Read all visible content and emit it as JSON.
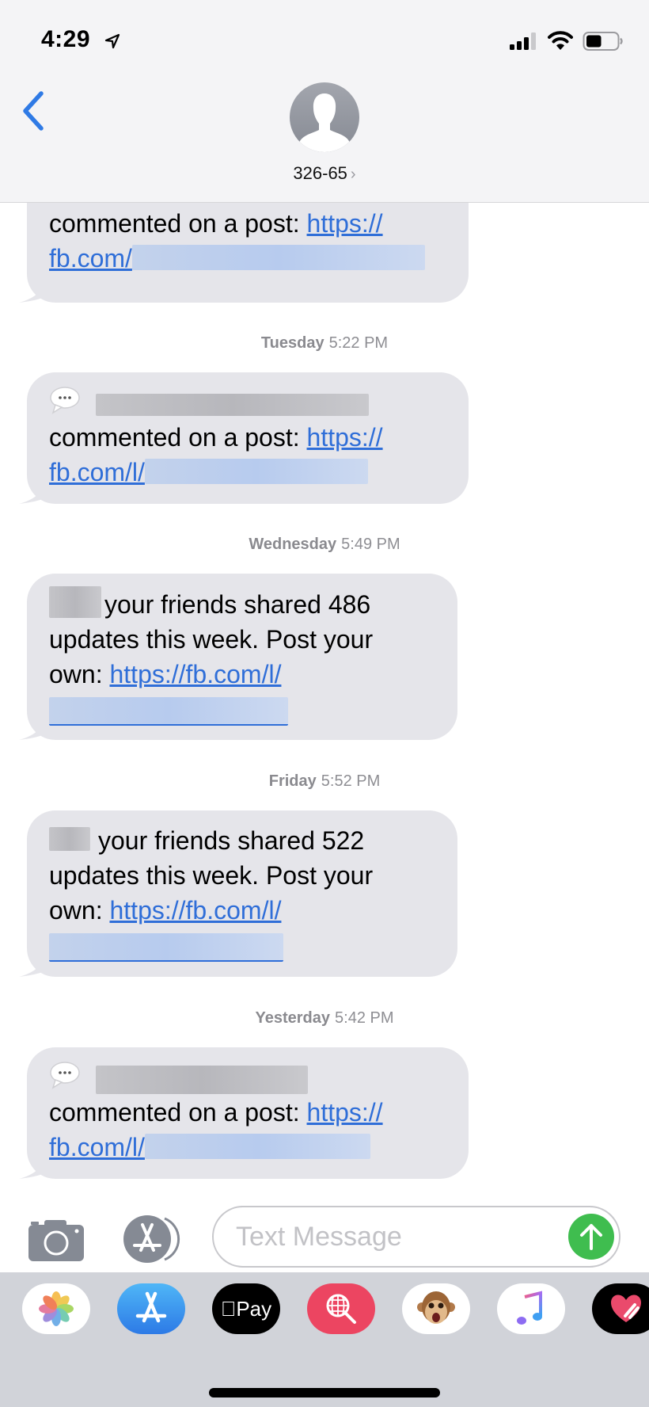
{
  "status_bar": {
    "time": "4:29",
    "location_icon": "location-arrow-icon",
    "signal_bars": 3,
    "signal_max": 4,
    "battery_level": 0.5
  },
  "header": {
    "back_icon": "chevron-left-icon",
    "contact_name": "326-65",
    "contact_chevron": "›",
    "avatar_icon": "person-silhouette-icon"
  },
  "messages": [
    {
      "type": "comment",
      "timestamp": null,
      "has_emoji": true,
      "body_text": "commented on a post:",
      "link_prefix": "https://",
      "link_line2": "fb.com/"
    },
    {
      "type": "comment",
      "timestamp": {
        "day": "Tuesday",
        "time": "5:22 PM"
      },
      "has_emoji": true,
      "body_text": "commented on a post:",
      "link_prefix": "https://",
      "link_line2": "fb.com/l/"
    },
    {
      "type": "weekly",
      "timestamp": {
        "day": "Wednesday",
        "time": "5:49 PM"
      },
      "line1": "your friends shared 486",
      "line2": "updates this week. Post your",
      "line3_text": "own:",
      "line3_link": "https://fb.com/l/"
    },
    {
      "type": "weekly",
      "timestamp": {
        "day": "Friday",
        "time": "5:52 PM"
      },
      "line1": "your friends shared 522",
      "line2": "updates this week. Post your",
      "line3_text": "own:",
      "line3_link": "https://fb.com/l/"
    },
    {
      "type": "comment",
      "timestamp": {
        "day": "Yesterday",
        "time": "5:42 PM"
      },
      "has_emoji": true,
      "body_text": "commented on a post:",
      "link_prefix": "https://",
      "link_line2": "fb.com/l/"
    }
  ],
  "composer": {
    "camera_icon": "camera-icon",
    "apps_icon": "app-store-icon",
    "placeholder": "Text Message",
    "send_icon": "arrow-up-icon",
    "send_color": "#3fbd4f"
  },
  "app_drawer": {
    "apps": [
      {
        "name": "Photos",
        "icon": "photos-icon"
      },
      {
        "name": "App Store",
        "icon": "app-store-icon"
      },
      {
        "name": "Apple Pay",
        "icon": "apple-pay-icon",
        "label": "Pay"
      },
      {
        "name": "Search Images",
        "icon": "globe-search-icon"
      },
      {
        "name": "Animoji",
        "icon": "monkey-animoji-icon"
      },
      {
        "name": "Music",
        "icon": "music-note-icon"
      },
      {
        "name": "Digital Touch",
        "icon": "heart-touch-icon"
      }
    ]
  },
  "colors": {
    "link": "#2f6ed8",
    "bubble": "#e5e5ea",
    "back_chevron": "#2f7ae5",
    "timestamp": "#8e8e93"
  }
}
